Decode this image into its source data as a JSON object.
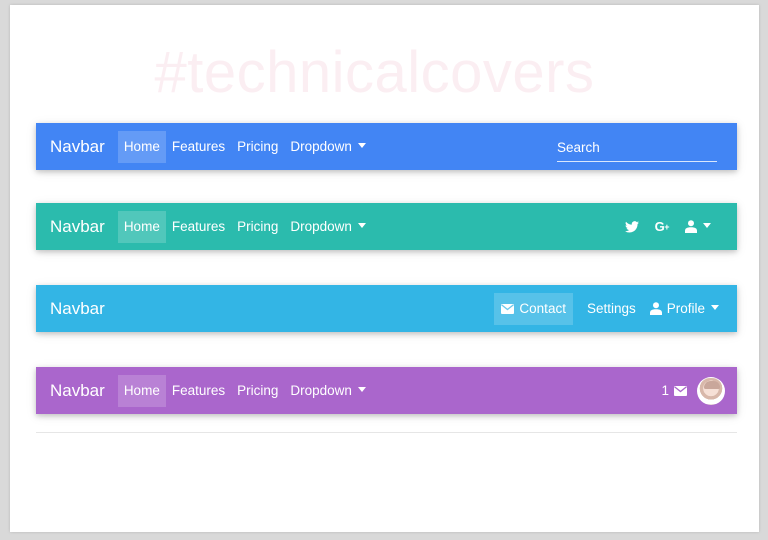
{
  "watermark": "#technicalcovers",
  "navbars": [
    {
      "brand": "Navbar",
      "color": "#4285f4",
      "links": [
        {
          "label": "Home"
        },
        {
          "label": "Features"
        },
        {
          "label": "Pricing"
        },
        {
          "label": "Dropdown"
        }
      ],
      "search": {
        "placeholder": "Search"
      }
    },
    {
      "brand": "Navbar",
      "color": "#2bbbad",
      "links": [
        {
          "label": "Home"
        },
        {
          "label": "Features"
        },
        {
          "label": "Pricing"
        },
        {
          "label": "Dropdown"
        }
      ],
      "icons": [
        "twitter-icon",
        "google-plus-icon",
        "user-icon"
      ],
      "gplus_text": "G",
      "gplus_sup": "+"
    },
    {
      "brand": "Navbar",
      "color": "#33b5e5",
      "contact_label": "Contact",
      "settings_label": "Settings",
      "profile_label": "Profile"
    },
    {
      "brand": "Navbar",
      "color": "#aa66cc",
      "links": [
        {
          "label": "Home"
        },
        {
          "label": "Features"
        },
        {
          "label": "Pricing"
        },
        {
          "label": "Dropdown"
        }
      ],
      "message_count": "1"
    }
  ]
}
